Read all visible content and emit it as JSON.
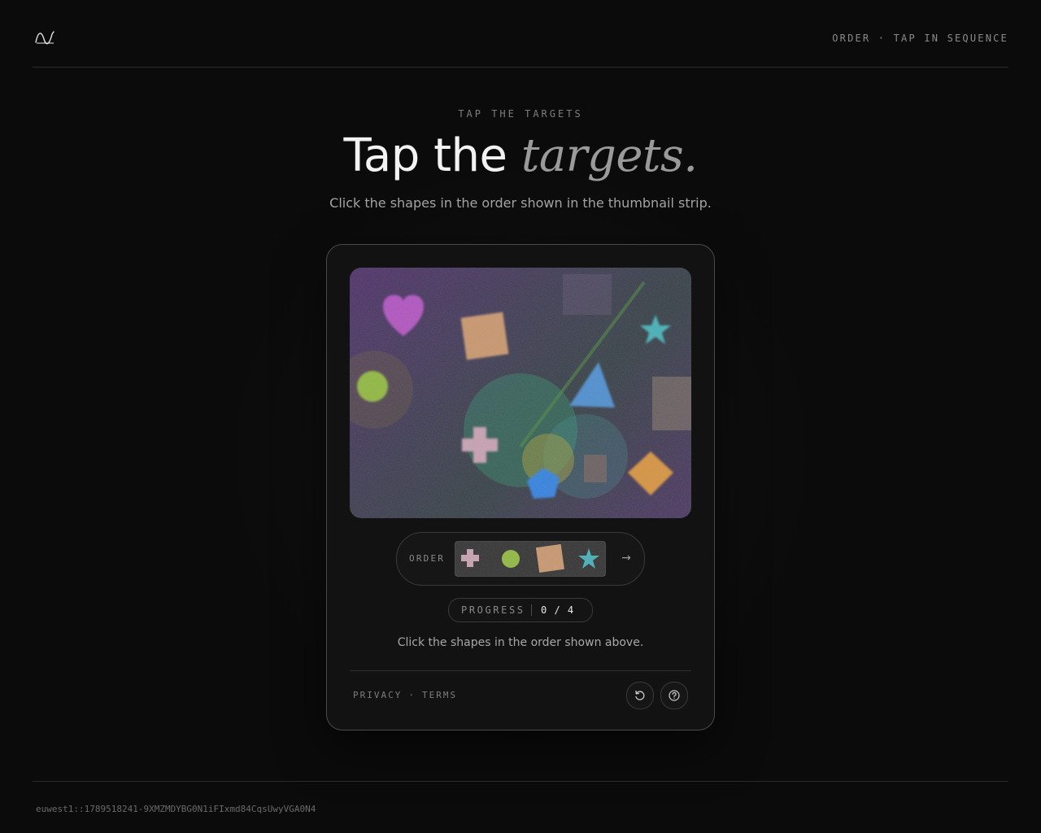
{
  "header": {
    "logo_icon": "wave-logo-icon",
    "tag": "ORDER · TAP IN SEQUENCE"
  },
  "hero": {
    "eyebrow": "TAP THE TARGETS",
    "title_plain": "Tap the",
    "title_emphasis": "targets.",
    "subtitle": "Click the shapes in the order shown in the thumbnail strip."
  },
  "challenge": {
    "canvas_shapes": [
      "heart",
      "square",
      "star",
      "circle",
      "triangle",
      "cross",
      "circle",
      "pentagon",
      "diamond",
      "square"
    ],
    "order_label": "ORDER",
    "order_sequence": [
      "cross",
      "circle",
      "square",
      "star"
    ],
    "next_icon": "arrow-right-icon",
    "progress_label": "PROGRESS",
    "progress_value": "0 / 4",
    "instruction": "Click the shapes in the order shown above."
  },
  "footer_links": {
    "privacy": "PRIVACY",
    "separator": "·",
    "terms": "TERMS"
  },
  "actions": {
    "refresh_icon": "refresh-icon",
    "help_icon": "help-icon"
  },
  "footer": {
    "session_id": "euwest1::1789518241-9XMZMDYBG0N1iFIxmd84CqsUwyVGA0N4"
  },
  "colors": {
    "background": "#0b0b0b",
    "card": "#121212",
    "heart": "#b04fc0",
    "square": "#c9956a",
    "star": "#3fb0b8",
    "circle": "#8fb83a",
    "triangle": "#4a8cd0",
    "cross": "#c8a0b0",
    "pentagon": "#2f7fe0",
    "diamond": "#d8923a"
  }
}
